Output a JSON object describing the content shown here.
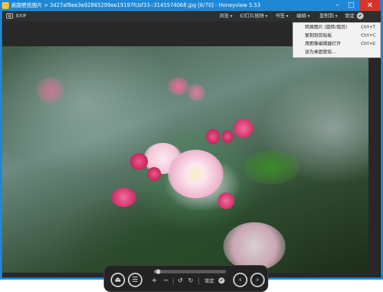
{
  "window": {
    "title": "桌面壁纸图片 > 3d27af8ee3e92865299ee19197fcbf33--3145574068.jpg [6/70] - Honeyview 5.53",
    "minimize": "–",
    "maximize": "□",
    "close": "✕"
  },
  "toolbar": {
    "exif": "EXIF",
    "menus": {
      "browse": "浏览",
      "slideshow": "幻灯片放映",
      "bookmark": "书签",
      "edit": "编辑",
      "copy": "复制到",
      "lock": "锁定"
    },
    "arrow": "▾",
    "lock_check": "✔"
  },
  "edit_menu": {
    "items": [
      {
        "label": "转换图片 (旋转/裁剪)",
        "shortcut": "Ctrl+T"
      },
      {
        "label": "复制到剪贴板",
        "shortcut": "Ctrl+C"
      },
      {
        "label": "用图像编辑器打开",
        "shortcut": "Ctrl+E"
      },
      {
        "label": "设为桌面壁纸...",
        "shortcut": ""
      }
    ]
  },
  "controls": {
    "eject": "⏏",
    "menu": "☰",
    "zoom_in": "+",
    "zoom_out": "−",
    "rotate_left": "↺",
    "rotate_right": "↻",
    "lock_label": "锁定",
    "lock_check": "✔",
    "prev": "‹",
    "next": "›",
    "position": 0.06
  }
}
